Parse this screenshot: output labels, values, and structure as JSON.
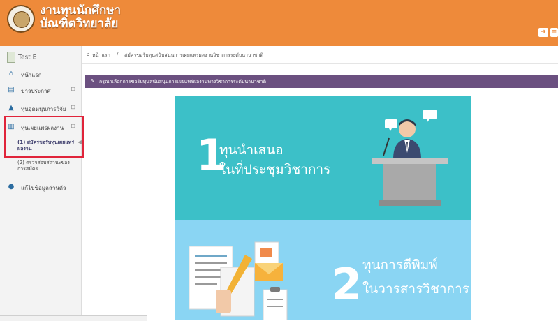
{
  "header": {
    "title_line1": "งานทุนนักศึกษา",
    "title_line2": "บัณฑิตวิทยาลัย",
    "buttons": [
      "exit-icon",
      "menu-icon"
    ]
  },
  "sidebar": {
    "user_name": "Test E",
    "items": [
      {
        "label": "หน้าแรก",
        "icon": "home-icon",
        "expander": ""
      },
      {
        "label": "ข่าวประกาศ",
        "icon": "news-icon",
        "expander": "⊞"
      },
      {
        "label": "ทุนอุดหนุนการวิจัย",
        "icon": "graduation-cap-icon",
        "expander": "⊞"
      },
      {
        "label": "ทุนเผยแพร่ผลงาน",
        "icon": "bar-chart-icon",
        "expander": "⊟"
      },
      {
        "label": "แก้ไขข้อมูลส่วนตัว",
        "icon": "user-icon",
        "expander": ""
      }
    ],
    "subitems": [
      "(1) สมัครขอรับทุนเผยแพร่ผลงาน",
      "(2) ตรวจสอบสถานะของการสมัคร"
    ]
  },
  "breadcrumb": {
    "home": "หน้าแรก",
    "separator": "/",
    "current": "สมัครขอรับทุนสนับสนุนการเผยแพร่ผลงานวิชาการระดับนานาชาติ"
  },
  "panel": {
    "title": "กรุณาเลือกการขอรับทุนสนับสนุนการเผยแพร่ผลงานทางวิชาการระดับนานาชาติ"
  },
  "poster": {
    "option1": {
      "number": "1",
      "line1": "ทุนนำเสนอ",
      "line2": "ในที่ประชุมวิชาการ"
    },
    "option2": {
      "number": "2",
      "line1": "ทุนการตีพิมพ์",
      "line2": "ในวารสารวิชาการ"
    }
  },
  "colors": {
    "header": "#ee8a3a",
    "panel_head": "#6b5080",
    "poster_top": "#3cc0c8",
    "poster_bottom": "#8ad5f3",
    "highlight": "#e0243a"
  }
}
